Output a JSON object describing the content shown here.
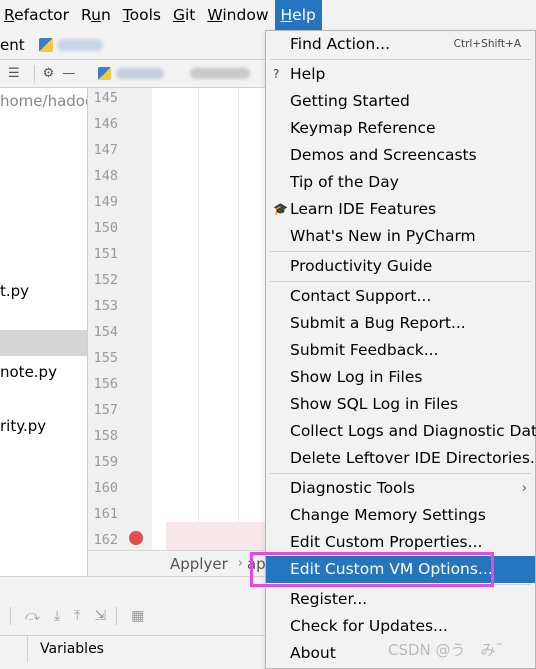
{
  "menubar": {
    "items": [
      {
        "label": "Refactor",
        "u": "R"
      },
      {
        "label": "Run",
        "u": "u"
      },
      {
        "label": "Tools",
        "u": "T"
      },
      {
        "label": "Git",
        "u": "G"
      },
      {
        "label": "Window",
        "u": "W"
      },
      {
        "label": "Help",
        "u": "H"
      }
    ]
  },
  "navbar": {
    "crumb": "ent"
  },
  "project": {
    "path": "home/hadoo",
    "files": [
      "t.py",
      "note.py",
      "rity.py"
    ]
  },
  "editor": {
    "line_numbers": [
      "145",
      "146",
      "147",
      "148",
      "149",
      "150",
      "151",
      "152",
      "153",
      "154",
      "155",
      "156",
      "157",
      "158",
      "159",
      "160",
      "161",
      "162"
    ],
    "breadcrumb": [
      "Applyer",
      "ap"
    ]
  },
  "debug": {
    "variables_label": "Variables"
  },
  "help_menu": {
    "items": [
      {
        "label": "Find Action...",
        "shortcut": "Ctrl+Shift+A"
      },
      {
        "label": "Help",
        "icon": "?"
      },
      {
        "label": "Getting Started"
      },
      {
        "label": "Keymap Reference"
      },
      {
        "label": "Demos and Screencasts"
      },
      {
        "label": "Tip of the Day"
      },
      {
        "label": "Learn IDE Features",
        "icon": "🎓"
      },
      {
        "label": "What's New in PyCharm"
      },
      {
        "label": "Productivity Guide"
      },
      {
        "label": "Contact Support..."
      },
      {
        "label": "Submit a Bug Report..."
      },
      {
        "label": "Submit Feedback..."
      },
      {
        "label": "Show Log in Files"
      },
      {
        "label": "Show SQL Log in Files"
      },
      {
        "label": "Collect Logs and Diagnostic Data"
      },
      {
        "label": "Delete Leftover IDE Directories..."
      },
      {
        "label": "Diagnostic Tools",
        "submenu": "›"
      },
      {
        "label": "Change Memory Settings"
      },
      {
        "label": "Edit Custom Properties..."
      },
      {
        "label": "Edit Custom VM Options..."
      },
      {
        "label": "Register..."
      },
      {
        "label": "Check for Updates..."
      },
      {
        "label": "About"
      }
    ]
  },
  "watermark": "CSDN @う　み˘",
  "colors": {
    "accent": "#2675bf",
    "callout": "#e24ae4",
    "breakpoint": "#e24d4d"
  }
}
